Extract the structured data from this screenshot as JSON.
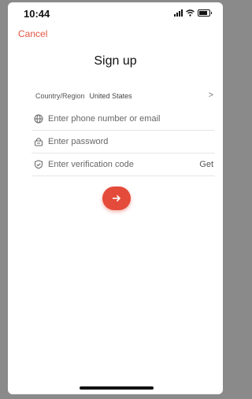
{
  "status_bar": {
    "time": "10:44"
  },
  "nav": {
    "cancel_label": "Cancel"
  },
  "page": {
    "title": "Sign up"
  },
  "form": {
    "country_label": "Country/Region",
    "country_value": "United States",
    "phone_placeholder": "Enter phone number or email",
    "password_placeholder": "Enter password",
    "code_placeholder": "Enter verification code",
    "get_code_label": "Get"
  },
  "colors": {
    "accent": "#e44b3a",
    "cancel": "#e25541"
  },
  "icons": {
    "phone_field": "globe-icon",
    "password_field": "lock-icon",
    "code_field": "shield-check-icon",
    "submit": "arrow-right-icon",
    "country_chevron": "chevron-right-icon"
  }
}
